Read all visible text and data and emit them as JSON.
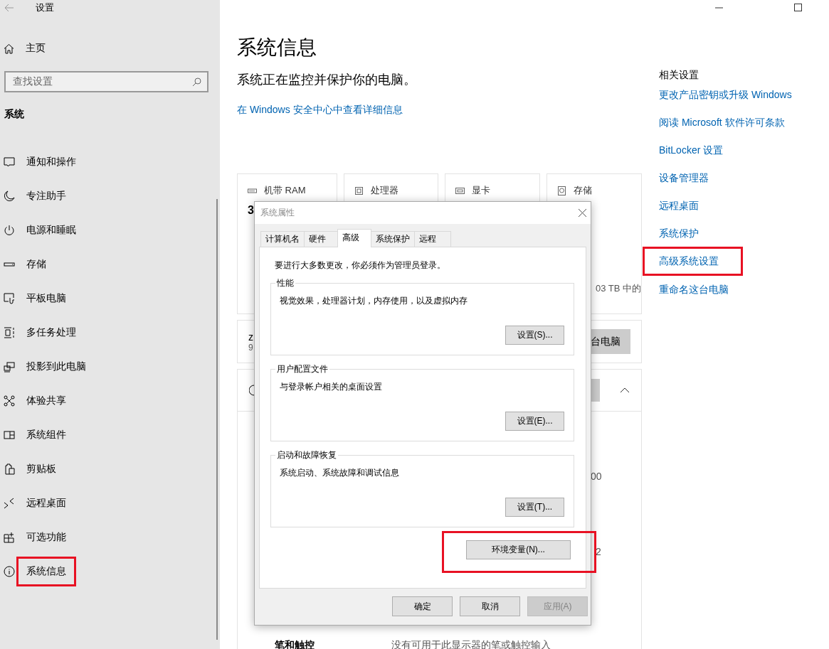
{
  "window": {
    "title": "设置"
  },
  "sidebar": {
    "home": "主页",
    "search": {
      "placeholder": "查找设置"
    },
    "section": "系统",
    "items": [
      {
        "kind": "notification",
        "label": "通知和操作",
        "highlighted": false
      },
      {
        "kind": "moon",
        "label": "专注助手",
        "highlighted": false
      },
      {
        "kind": "power",
        "label": "电源和睡眠",
        "highlighted": false
      },
      {
        "kind": "storage",
        "label": "存储",
        "highlighted": false
      },
      {
        "kind": "tablet",
        "label": "平板电脑",
        "highlighted": false
      },
      {
        "kind": "multitask",
        "label": "多任务处理",
        "highlighted": false
      },
      {
        "kind": "project",
        "label": "投影到此电脑",
        "highlighted": false
      },
      {
        "kind": "share",
        "label": "体验共享",
        "highlighted": false
      },
      {
        "kind": "components",
        "label": "系统组件",
        "highlighted": false
      },
      {
        "kind": "clipboard",
        "label": "剪贴板",
        "highlighted": false
      },
      {
        "kind": "remote",
        "label": "远程桌面",
        "highlighted": false
      },
      {
        "kind": "features",
        "label": "可选功能",
        "highlighted": false
      },
      {
        "kind": "info",
        "label": "系统信息",
        "highlighted": true
      }
    ]
  },
  "page": {
    "title": "系统信息",
    "subtitle": "系统正在监控并保护你的电脑。",
    "security_link": "在 Windows 安全中心中查看详细信息",
    "specs": [
      {
        "kind": "ram",
        "label": "机带 RAM",
        "value": "3"
      },
      {
        "kind": "cpu",
        "label": "处理器"
      },
      {
        "kind": "gpu",
        "label": "显卡"
      },
      {
        "kind": "disk",
        "label": "存储",
        "detail": "03 TB 中的"
      }
    ],
    "device_card": {
      "line_1": "z",
      "line_2": "9",
      "button": "台电脑"
    },
    "specs_panel": {
      "column_3": "00",
      "column_4": "2",
      "rows": [
        {
          "label": "笔和触控",
          "value": "没有可用于此显示器的笔或触控输入"
        }
      ]
    }
  },
  "related": {
    "heading": "相关设置",
    "links": [
      {
        "label": "更改产品密钥或升级 Windows",
        "highlighted": false
      },
      {
        "label": "阅读 Microsoft 软件许可条款",
        "highlighted": false
      },
      {
        "label": "BitLocker 设置",
        "highlighted": false
      },
      {
        "label": "设备管理器",
        "highlighted": false
      },
      {
        "label": "远程桌面",
        "highlighted": false
      },
      {
        "label": "系统保护",
        "highlighted": false
      },
      {
        "label": "高级系统设置",
        "highlighted": true
      },
      {
        "label": "重命名这台电脑",
        "highlighted": false
      }
    ]
  },
  "dialog": {
    "title": "系统属性",
    "tabs": [
      {
        "label": "计算机名",
        "selected": false
      },
      {
        "label": "硬件",
        "selected": false
      },
      {
        "label": "高级",
        "selected": true
      },
      {
        "label": "系统保护",
        "selected": false
      },
      {
        "label": "远程",
        "selected": false
      }
    ],
    "notice": "要进行大多数更改，你必须作为管理员登录。",
    "groups": [
      {
        "title": "性能",
        "description": "视觉效果，处理器计划，内存使用，以及虚拟内存",
        "button": "设置(S)..."
      },
      {
        "title": "用户配置文件",
        "description": "与登录帐户相关的桌面设置",
        "button": "设置(E)..."
      },
      {
        "title": "启动和故障恢复",
        "description": "系统启动、系统故障和调试信息",
        "button": "设置(T)..."
      }
    ],
    "env_button": {
      "label": "环境变量(N)...",
      "highlighted": true
    },
    "buttons": [
      {
        "label": "确定",
        "disabled": false
      },
      {
        "label": "取消",
        "disabled": false
      },
      {
        "label": "应用(A)",
        "disabled": true
      }
    ]
  }
}
